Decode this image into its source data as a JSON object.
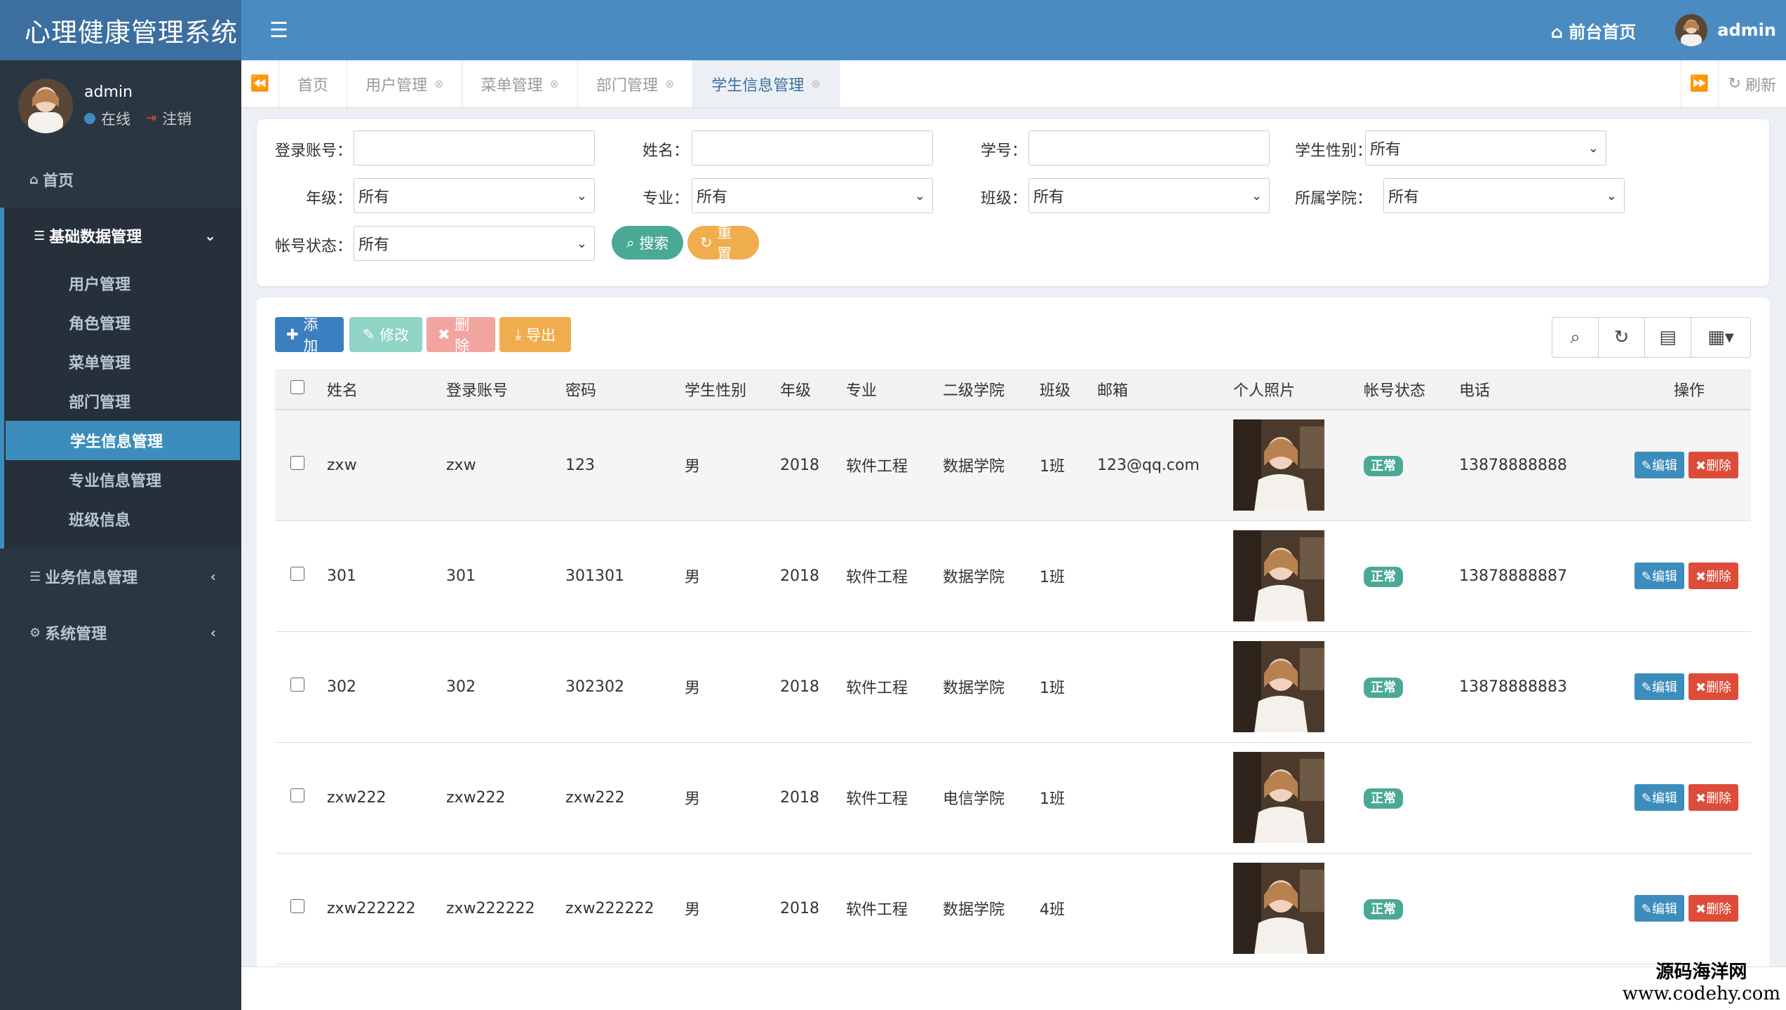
{
  "app": {
    "title": "心理健康管理系统"
  },
  "user_panel": {
    "name": "admin",
    "online": "在线",
    "logout": "注销"
  },
  "sidebar": {
    "home": "首页",
    "basic_group": "基础数据管理",
    "basic_items": [
      "用户管理",
      "角色管理",
      "菜单管理",
      "部门管理",
      "学生信息管理",
      "专业信息管理",
      "班级信息"
    ],
    "business": "业务信息管理",
    "system": "系统管理"
  },
  "header": {
    "front_home": "前台首页",
    "admin": "admin"
  },
  "tabs": {
    "items": [
      "首页",
      "用户管理",
      "菜单管理",
      "部门管理",
      "学生信息管理"
    ],
    "refresh": "刷新"
  },
  "search": {
    "labels": {
      "account": "登录账号：",
      "name": "姓名：",
      "student_no": "学号：",
      "gender": "学生性别：",
      "grade": "年级：",
      "major": "专业：",
      "class": "班级：",
      "college": "所属学院：",
      "status": "帐号状态："
    },
    "select_default": "所有",
    "search_btn": "搜索",
    "reset_btn": "重置"
  },
  "toolbar": {
    "add": "添加",
    "edit": "修改",
    "delete": "删除",
    "export": "导出"
  },
  "table": {
    "headers": [
      "姓名",
      "登录账号",
      "密码",
      "学生性别",
      "年级",
      "专业",
      "二级学院",
      "班级",
      "邮箱",
      "个人照片",
      "帐号状态",
      "电话",
      "操作"
    ],
    "rows": [
      {
        "name": "zxw",
        "account": "zxw",
        "password": "123",
        "gender": "男",
        "grade": "2018",
        "major": "软件工程",
        "college": "数据学院",
        "class": "1班",
        "email": "123@qq.com",
        "status": "正常",
        "phone": "13878888888"
      },
      {
        "name": "301",
        "account": "301",
        "password": "301301",
        "gender": "男",
        "grade": "2018",
        "major": "软件工程",
        "college": "数据学院",
        "class": "1班",
        "email": "",
        "status": "正常",
        "phone": "13878888887"
      },
      {
        "name": "302",
        "account": "302",
        "password": "302302",
        "gender": "男",
        "grade": "2018",
        "major": "软件工程",
        "college": "数据学院",
        "class": "1班",
        "email": "",
        "status": "正常",
        "phone": "13878888883"
      },
      {
        "name": "zxw222",
        "account": "zxw222",
        "password": "zxw222",
        "gender": "男",
        "grade": "2018",
        "major": "软件工程",
        "college": "电信学院",
        "class": "1班",
        "email": "",
        "status": "正常",
        "phone": ""
      },
      {
        "name": "zxw222222",
        "account": "zxw222222",
        "password": "zxw222222",
        "gender": "男",
        "grade": "2018",
        "major": "软件工程",
        "college": "数据学院",
        "class": "4班",
        "email": "",
        "status": "正常",
        "phone": ""
      }
    ],
    "edit_label": "编辑",
    "delete_label": "删除"
  },
  "watermark": {
    "line1": "源码海洋网",
    "line2": "www.codehy.com"
  },
  "colors": {
    "primary": "#3c8dbc",
    "success": "#4aa995",
    "danger": "#dd4b39",
    "warning": "#f0ad4e",
    "sidebar": "#2b3643"
  }
}
